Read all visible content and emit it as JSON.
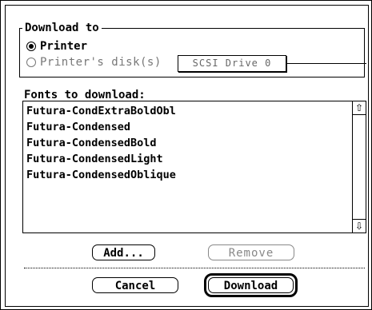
{
  "dialog": {
    "download_to": {
      "legend": "Download to",
      "options": [
        {
          "label": "Printer",
          "selected": true,
          "enabled": true
        },
        {
          "label": "Printer's disk(s)",
          "selected": false,
          "enabled": false
        }
      ],
      "disk_popup_value": "SCSI Drive 0"
    },
    "fonts_label": "Fonts to download:",
    "fonts": [
      "Futura-CondExtraBoldObl",
      "Futura-Condensed",
      "Futura-CondensedBold",
      "Futura-CondensedLight",
      "Futura-CondensedOblique"
    ],
    "scroll_up_glyph": "⇧",
    "scroll_down_glyph": "⇩",
    "buttons": {
      "add": "Add...",
      "remove": "Remove",
      "cancel": "Cancel",
      "download": "Download"
    }
  }
}
